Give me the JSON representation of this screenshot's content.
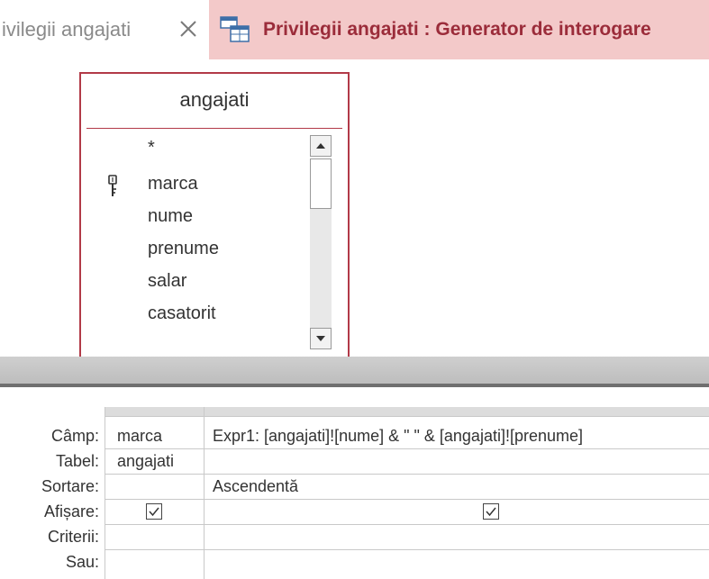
{
  "tabs": [
    {
      "label": "ivilegii angajati",
      "active": false,
      "close_icon": "close-icon"
    },
    {
      "label": "Privilegii angajati : Generator de interogare",
      "active": true,
      "icon": "query-design-icon"
    }
  ],
  "table_box": {
    "title": "angajati",
    "fields": [
      "*",
      "marca",
      "nume",
      "prenume",
      "salar",
      "casatorit"
    ],
    "primary_key_field": "marca"
  },
  "grid": {
    "row_labels": [
      "Câmp:",
      "Tabel:",
      "Sortare:",
      "Afișare:",
      "Criterii:",
      "Sau:"
    ],
    "columns": [
      {
        "camp": "marca",
        "tabel": "angajati",
        "sortare": "",
        "afisare": true
      },
      {
        "camp": "Expr1: [angajati]![nume] & \" \" & [angajati]![prenume]",
        "tabel": "",
        "sortare": "Ascendentă",
        "afisare": true
      }
    ]
  },
  "colors": {
    "active_tab_bg": "#f3c9c9",
    "active_tab_text": "#9b2c3a",
    "table_border": "#b23a48"
  }
}
